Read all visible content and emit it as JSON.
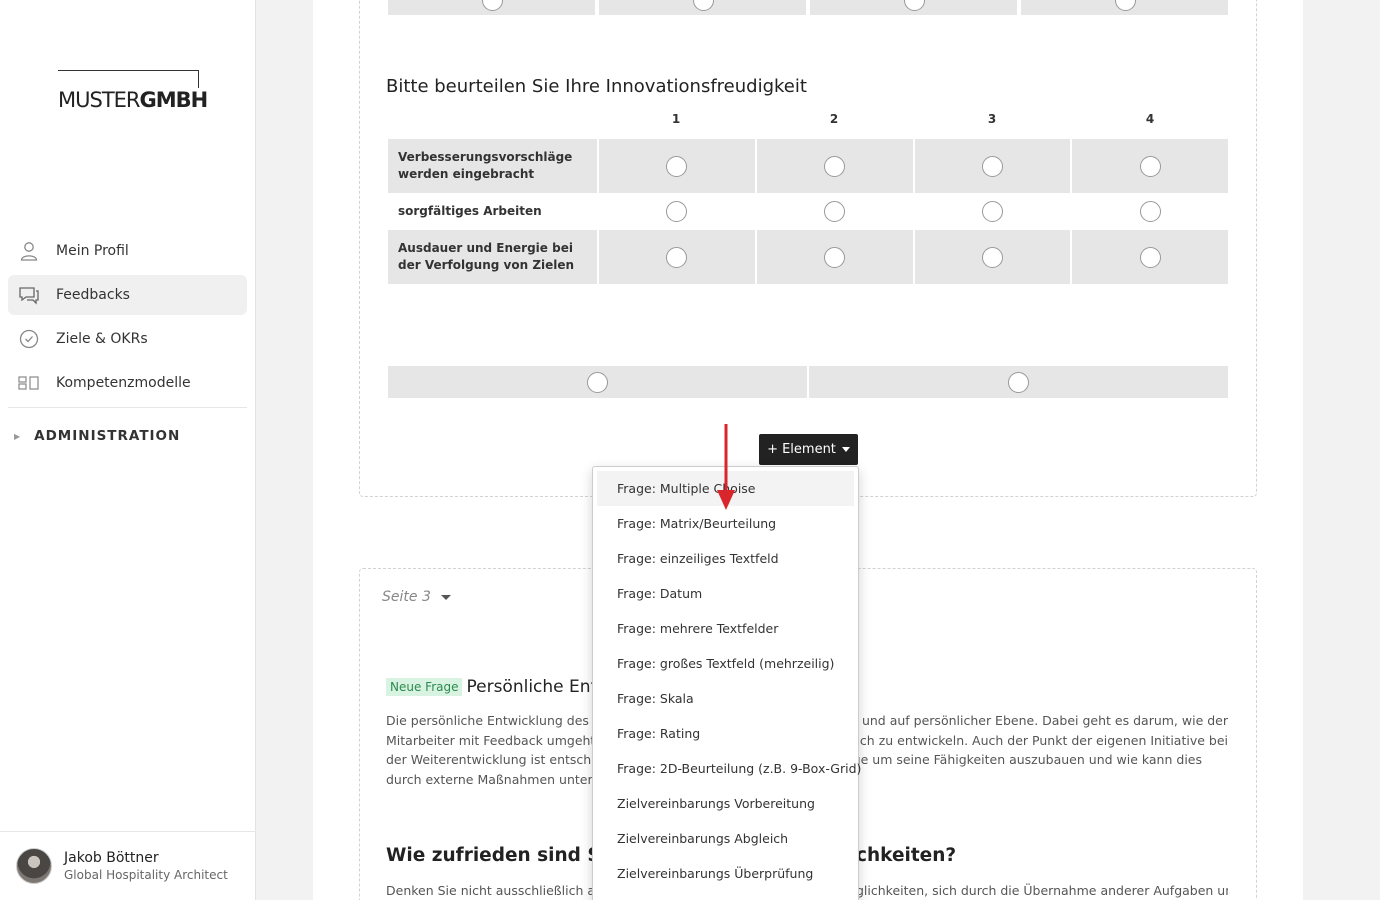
{
  "brand": {
    "logo_light": "MUSTER",
    "logo_bold": "GMBH"
  },
  "sidebar": {
    "items": [
      {
        "label": "Mein Profil",
        "icon": "user-icon"
      },
      {
        "label": "Feedbacks",
        "icon": "chat-icon",
        "active": true
      },
      {
        "label": "Ziele & OKRs",
        "icon": "check-circle-icon"
      },
      {
        "label": "Kompetenzmodelle",
        "icon": "model-icon"
      }
    ],
    "admin_label": "ADMINISTRATION"
  },
  "user": {
    "name": "Jakob Böttner",
    "role": "Global Hospitality Architect"
  },
  "question1": {
    "title": "Bitte beurteilen Sie Ihre Innovationsfreudigkeit",
    "columns": [
      "1",
      "2",
      "3",
      "4"
    ],
    "rows": [
      "Verbesserungsvorschläge wer­den eingebracht",
      "sorgfältiges Arbeiten",
      "Ausdauer und Energie bei der Verfolgung von Zielen"
    ]
  },
  "element_button": "+ Element",
  "dropdown": {
    "items": [
      "Frage: Multiple Choise",
      "Frage: Matrix/Beurteilung",
      "Frage: einzeiliges Textfeld",
      "Frage: Datum",
      "Frage: mehrere Textfelder",
      "Frage: großes Textfeld (mehrzeilig)",
      "Frage: Skala",
      "Frage: Rating",
      "Frage: 2D-Beurteilung (z.B. 9-Box-Grid)",
      "Zielvereinbarungs Vorbereitung",
      "Zielvereinbarungs Abgleich",
      "Zielvereinbarungs Überprüfung"
    ]
  },
  "page3": {
    "label": "Seite 3",
    "badge": "Neue Frage",
    "title": "Persönliche Entw",
    "para_left": "Die persönliche Entwicklung des Mi",
    "para_left_2": "Mitarbeiter mit Feedback umgeht u",
    "para_left_3": "der Weiterentwicklung ist entscheid",
    "para_left_4": "durch externe Maßnahmen unters",
    "para_right": "cher und auf persönlicher Ebene. Dabei geht es darum, wie der",
    "para_right_2": "nd sich zu entwickeln. Auch der Punkt der eigenen Initiative bei",
    "para_right_3": "enige um seine Fähigkeiten auszubauen und wie kann dies",
    "q2_left": "Wie zufrieden sind Sie",
    "q2_right": "chkeiten?",
    "para2_left": "Denken Sie nicht ausschließlich an Tr",
    "para2_right": "glichkeiten, sich durch die Übernahme anderer Aufgaben und"
  },
  "colors": {
    "accent_arrow": "#d9262c",
    "badge_bg": "#d9f3e2",
    "badge_text": "#2d8a4e"
  }
}
